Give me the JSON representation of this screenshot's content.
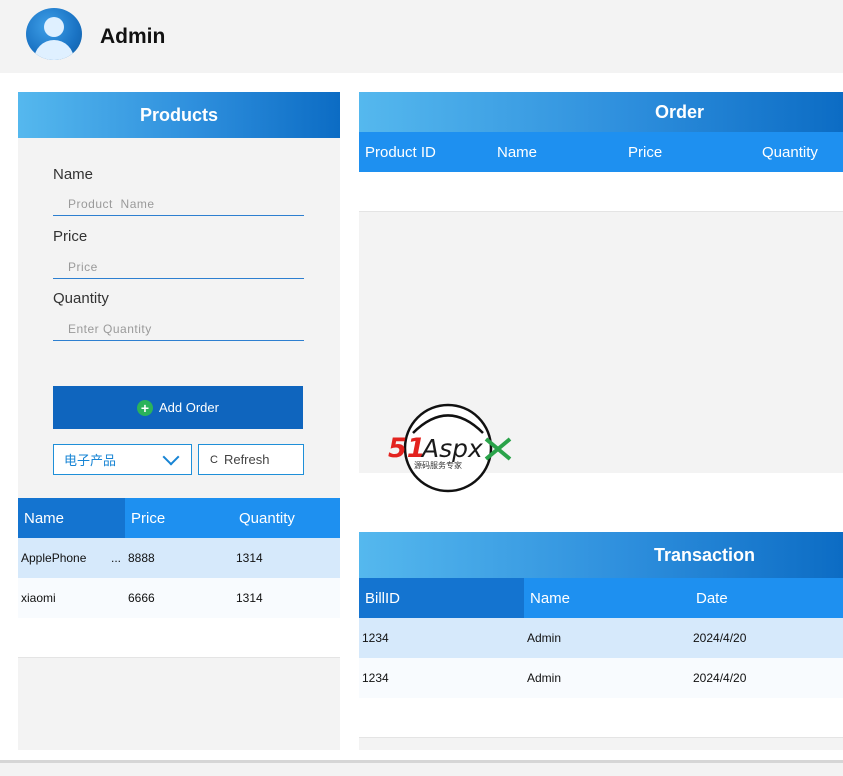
{
  "header": {
    "title": "Admin"
  },
  "products": {
    "title": "Products",
    "fields": [
      {
        "label": "Name",
        "placeholder": "Product  Name"
      },
      {
        "label": "Price",
        "placeholder": "Price"
      },
      {
        "label": "Quantity",
        "placeholder": "Enter Quantity"
      }
    ],
    "add_order_label": "Add Order",
    "category_selected": "电子产品",
    "refresh_label": "Refresh",
    "refresh_icon_glyph": "C",
    "table": {
      "columns": [
        "Name",
        "Price",
        "Quantity"
      ],
      "rows": [
        {
          "name": "ApplePhone",
          "ellipsis": "...",
          "price": "8888",
          "quantity": "1314"
        },
        {
          "name": "xiaomi",
          "ellipsis": "",
          "price": "6666",
          "quantity": "1314"
        }
      ]
    }
  },
  "order": {
    "title": "Order",
    "columns": [
      "Product ID",
      "Name",
      "Price",
      "Quantity"
    ]
  },
  "transaction": {
    "title": "Transaction",
    "columns": [
      "BillID",
      "Name",
      "Date"
    ],
    "rows": [
      {
        "billid": "1234",
        "name": "Admin",
        "date": "2024/4/20"
      },
      {
        "billid": "1234",
        "name": "Admin",
        "date": "2024/4/20"
      }
    ]
  },
  "watermark": {
    "brand": "51Aspx",
    "tagline": "源码服务专家"
  },
  "colors": {
    "accent": "#1e90f0",
    "button": "#0f65be",
    "selected_row": "#d6e9fb",
    "panel_bg": "#f3f3f3",
    "plus_icon": "#2bb35a"
  },
  "icons": [
    "user-avatar-icon",
    "plus-icon",
    "chevron-down-icon",
    "refresh-icon"
  ]
}
